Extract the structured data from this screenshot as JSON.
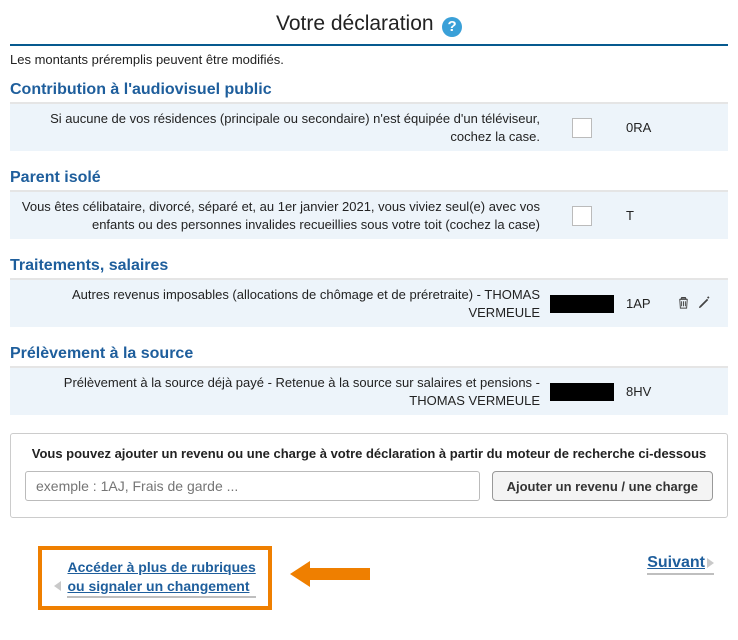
{
  "header": {
    "title": "Votre déclaration",
    "help_glyph": "?"
  },
  "info_line": "Les montants préremplis peuvent être modifiés.",
  "sections": [
    {
      "title": "Contribution à l'audiovisuel public",
      "row": {
        "desc": "Si aucune de vos résidences (principale ou secondaire) n'est équipée d'un téléviseur, cochez la case.",
        "type": "checkbox",
        "code": "0RA"
      }
    },
    {
      "title": "Parent isolé",
      "row": {
        "desc": "Vous êtes célibataire, divorcé, séparé et, au 1er janvier 2021, vous viviez seul(e) avec vos enfants ou des personnes invalides recueillies sous votre toit (cochez la case)",
        "type": "checkbox",
        "code": "T"
      }
    },
    {
      "title": "Traitements, salaires",
      "row": {
        "desc": "Autres revenus imposables (allocations de chômage et de préretraite) - THOMAS VERMEULE",
        "type": "value",
        "code": "1AP",
        "tools": true
      }
    },
    {
      "title": "Prélèvement à la source",
      "row": {
        "desc": "Prélèvement à la source déjà payé - Retenue à la source sur salaires et pensions - THOMAS VERMEULE",
        "type": "value",
        "code": "8HV"
      }
    }
  ],
  "add_box": {
    "heading": "Vous pouvez ajouter un revenu ou une charge à votre déclaration à partir du moteur de recherche ci-dessous",
    "placeholder": "exemple : 1AJ, Frais de garde ...",
    "button": "Ajouter un revenu / une charge"
  },
  "nav": {
    "left_line1": "Accéder à plus de rubriques",
    "left_line2": "ou signaler un changement",
    "right": "Suivant"
  }
}
